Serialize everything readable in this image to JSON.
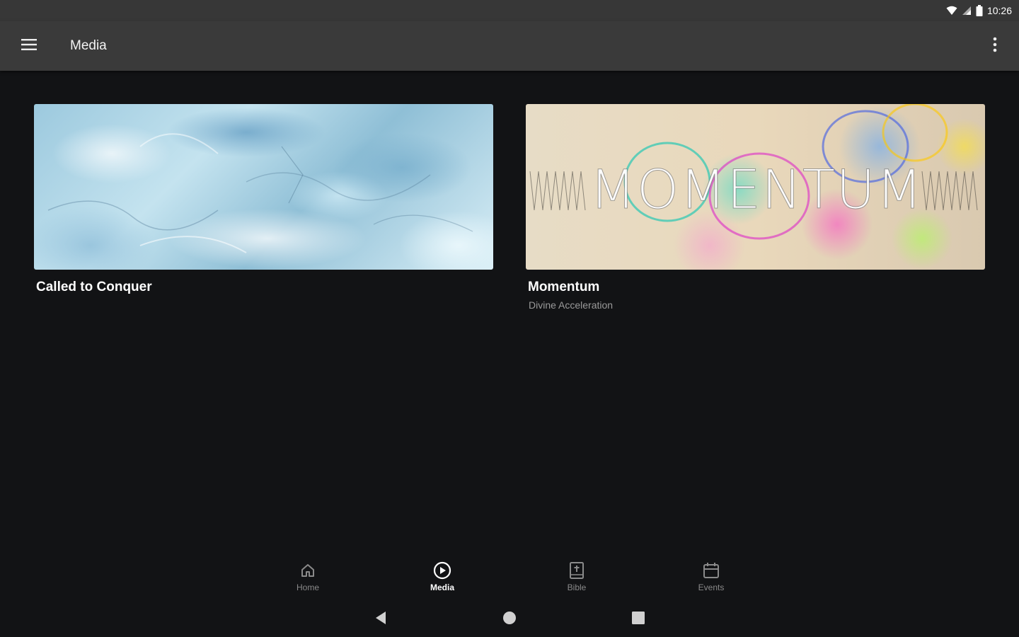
{
  "status_bar": {
    "time": "10:26"
  },
  "app_bar": {
    "title": "Media"
  },
  "media": [
    {
      "title": "Called to Conquer",
      "subtitle": ""
    },
    {
      "title": "Momentum",
      "subtitle": "Divine Acceleration",
      "artwork_text": "MOMENTUM"
    }
  ],
  "bottom_nav": {
    "items": [
      {
        "label": "Home",
        "icon": "home-icon",
        "active": false
      },
      {
        "label": "Media",
        "icon": "play-circle-icon",
        "active": true
      },
      {
        "label": "Bible",
        "icon": "bible-icon",
        "active": false
      },
      {
        "label": "Events",
        "icon": "calendar-icon",
        "active": false
      }
    ]
  },
  "colors": {
    "background": "#121315",
    "app_bar": "#3a3a3a",
    "status_bar": "#373737",
    "inactive_label": "#8a8a8a",
    "subtitle": "#9a9a9a"
  }
}
